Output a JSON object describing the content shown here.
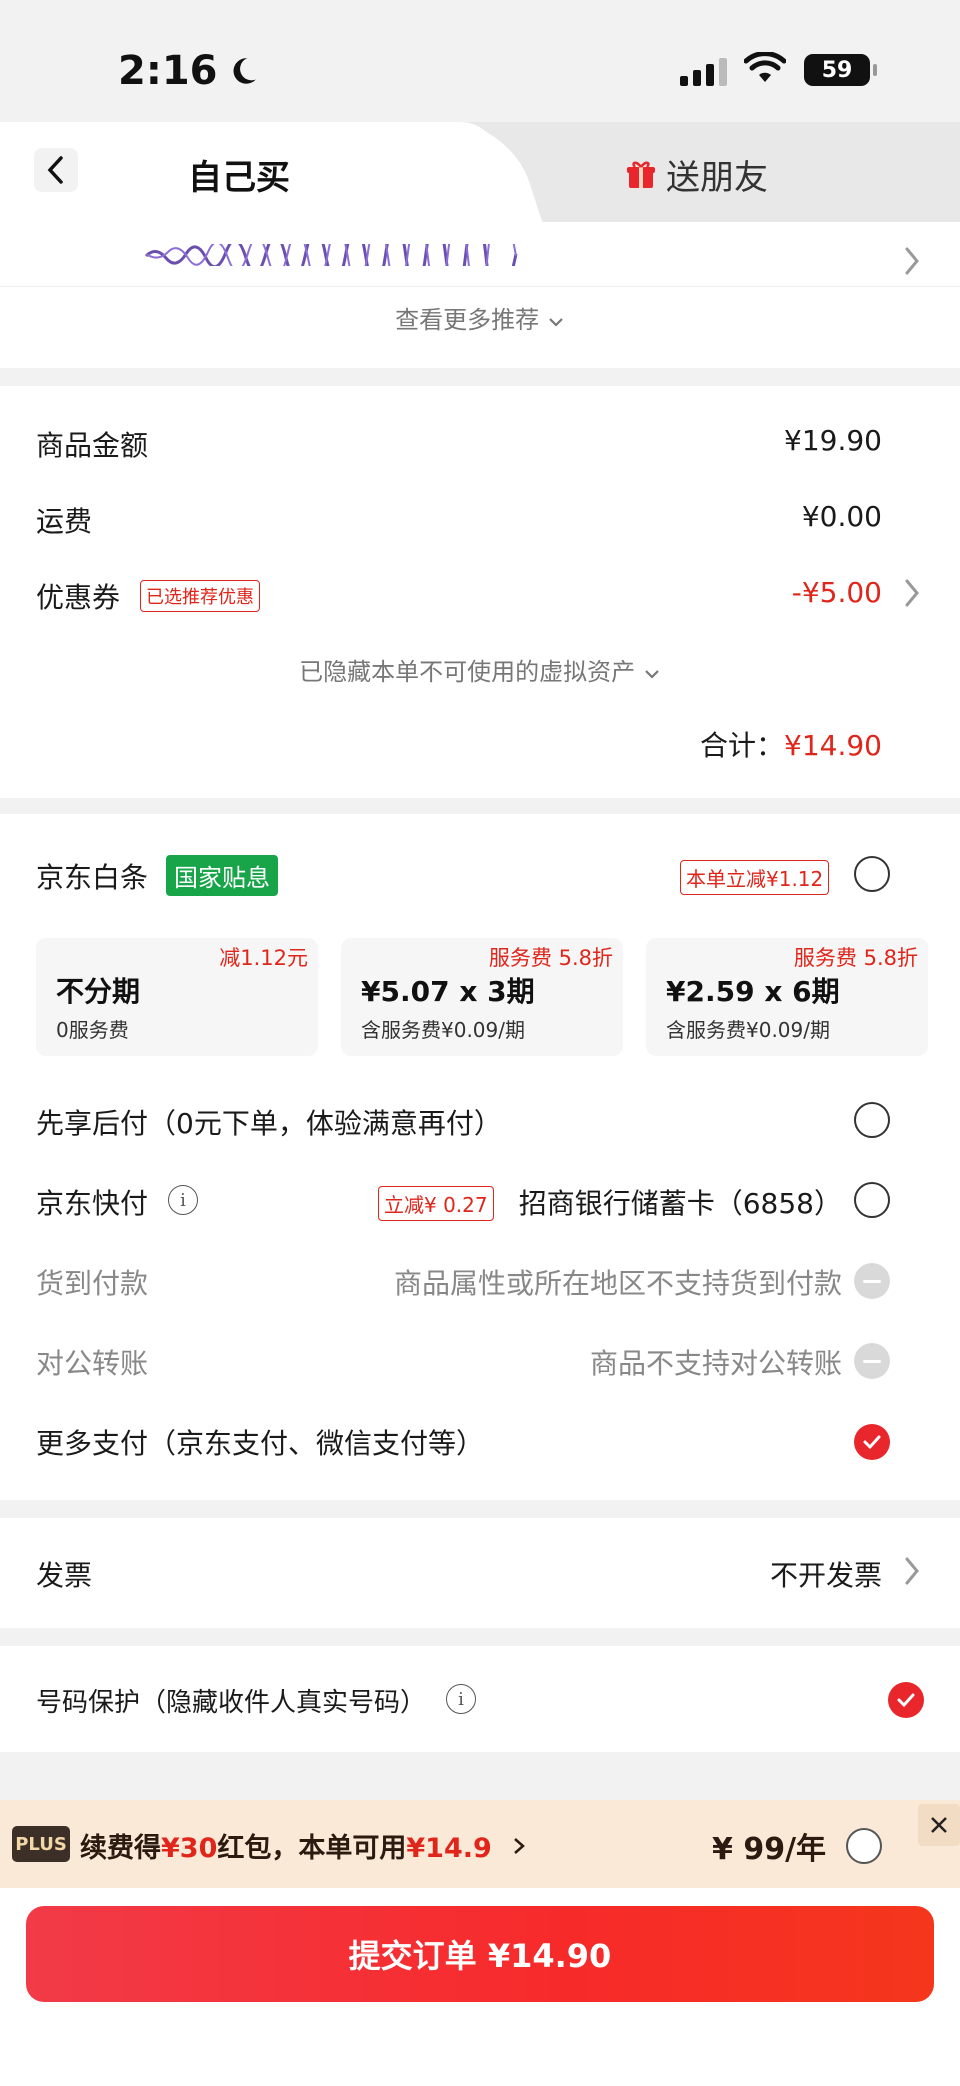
{
  "status_bar": {
    "time": "2:16",
    "battery": "59"
  },
  "tabs": {
    "self_buy": "自己买",
    "gift_friend": "送朋友"
  },
  "recommend": {
    "more_label": "查看更多推荐"
  },
  "amount": {
    "goods_label": "商品金额",
    "goods_value": "¥19.90",
    "shipping_label": "运费",
    "shipping_value": "¥0.00",
    "coupon_label": "优惠券",
    "coupon_tag": "已选推荐优惠",
    "coupon_value": "-¥5.00",
    "hidden_assets": "已隐藏本单不可使用的虚拟资产",
    "total_label": "合计：",
    "total_value": "¥14.90"
  },
  "payment": {
    "baitiao_label": "京东白条",
    "baitiao_badge": "国家贴息",
    "baitiao_discount": "本单立减¥1.12",
    "plans": [
      {
        "tag": "减1.12元",
        "main": "不分期",
        "sub": "0服务费"
      },
      {
        "tag": "服务费 5.8折",
        "main": "¥5.07 x 3期",
        "sub": "含服务费¥0.09/期"
      },
      {
        "tag": "服务费 5.8折",
        "main": "¥2.59 x 6期",
        "sub": "含服务费¥0.09/期"
      }
    ],
    "pay_later": "先享后付（0元下单，体验满意再付）",
    "quickpay_label": "京东快付",
    "quickpay_tag": "立减¥ 0.27",
    "quickpay_card": "招商银行储蓄卡（6858）",
    "cod_label": "货到付款",
    "cod_note": "商品属性或所在地区不支持货到付款",
    "transfer_label": "对公转账",
    "transfer_note": "商品不支持对公转账",
    "more_pay": "更多支付（京东支付、微信支付等）"
  },
  "invoice": {
    "label": "发票",
    "value": "不开发票"
  },
  "phone_protect": {
    "label": "号码保护（隐藏收件人真实号码）"
  },
  "plus": {
    "logo": "PLUS",
    "text_a": "续费得",
    "text_red1": "¥30",
    "text_b": "红包，本单可用",
    "text_red2": "¥14.9",
    "price": "¥ 99/年"
  },
  "submit": {
    "label": "提交订单 ¥14.90"
  },
  "colors": {
    "accent": "#e0261b",
    "green": "#18a54a",
    "plus_bg": "#fbe9d7"
  }
}
